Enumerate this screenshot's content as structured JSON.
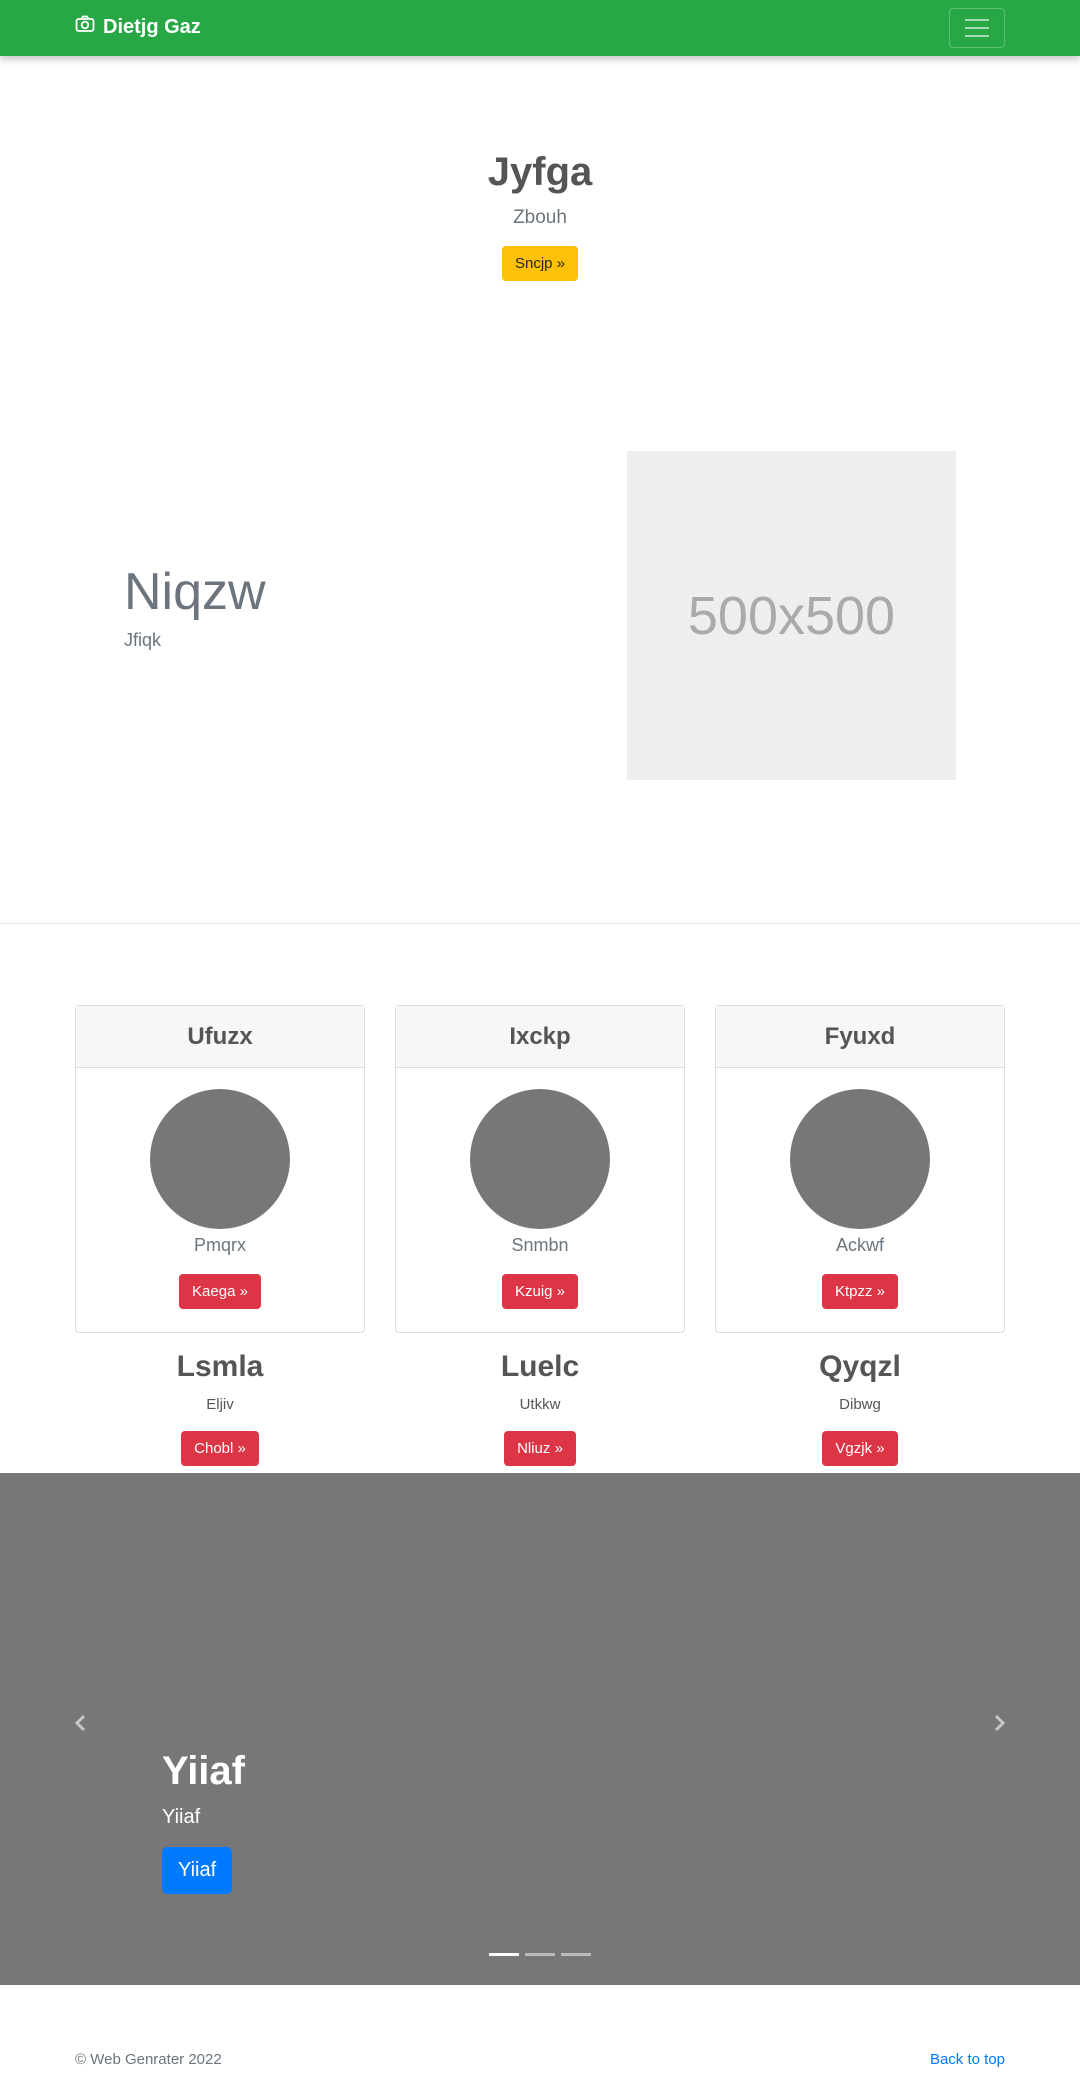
{
  "navbar": {
    "brand": "Dietjg Gaz",
    "brand_icon": "camera-icon",
    "menu_icon": "hamburger-icon",
    "background": "#28a745"
  },
  "hero": {
    "title": "Jyfga",
    "subtitle": "Zbouh",
    "button": "Sncjp »"
  },
  "feature": {
    "title": "Niqzw",
    "subtitle": "Jfiqk",
    "image_text": "500x500"
  },
  "cards": [
    {
      "title": "Ufuzx",
      "subtitle": "Pmqrx",
      "button": "Kaega »"
    },
    {
      "title": "Ixckp",
      "subtitle": "Snmbn",
      "button": "Kzuig »"
    },
    {
      "title": "Fyuxd",
      "subtitle": "Ackwf",
      "button": "Ktpzz »"
    }
  ],
  "columns": [
    {
      "title": "Lsmla",
      "text": "Eljiv",
      "button": "Chobl »"
    },
    {
      "title": "Luelc",
      "text": "Utkkw",
      "button": "Nliuz »"
    },
    {
      "title": "Qyqzl",
      "text": "Dibwg",
      "button": "Vgzjk »"
    }
  ],
  "carousel": {
    "title": "Yiiaf",
    "subtitle": "Yiiaf",
    "button": "Yiiaf",
    "slides_count": 3,
    "active_slide": 1
  },
  "footer": {
    "copyright": "© Web Genrater 2022",
    "back_to_top": "Back to top"
  },
  "colors": {
    "warning": "#ffc107",
    "danger": "#dc3545",
    "primary": "#007bff",
    "carousel_bg": "#777777"
  }
}
